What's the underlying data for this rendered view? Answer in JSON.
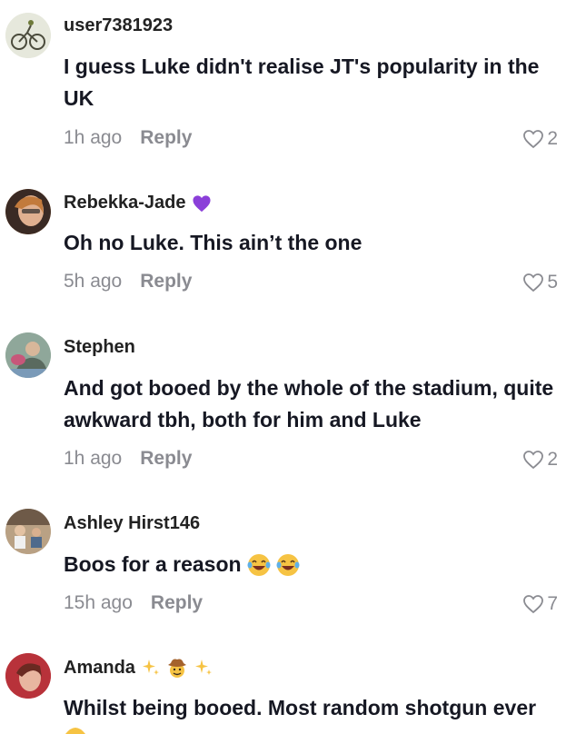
{
  "comments": [
    {
      "username": "user7381923",
      "text": "I guess Luke didn't realise JT's popularity in the UK",
      "time": "1h ago",
      "reply_label": "Reply",
      "likes": "2"
    },
    {
      "username": "Rebekka-Jade",
      "badge_icon": "purple-heart-icon",
      "text": "Oh no Luke. This ain’t the one",
      "time": "5h ago",
      "reply_label": "Reply",
      "likes": "5"
    },
    {
      "username": "Stephen",
      "text": "And got booed by the whole of the stadium, quite awkward tbh, both for him and Luke",
      "time": "1h ago",
      "reply_label": "Reply",
      "likes": "2"
    },
    {
      "username": "Ashley Hirst146",
      "text": "Boos for a reason",
      "text_emojis": [
        "laughing-crying-emoji",
        "laughing-crying-emoji"
      ],
      "time": "15h ago",
      "reply_label": "Reply",
      "likes": "7"
    },
    {
      "username": "Amanda",
      "name_emojis": [
        "sparkles-emoji",
        "cowboy-emoji",
        "sparkles-emoji"
      ],
      "text": "Whilst being booed. Most random shotgun ever"
    }
  ],
  "colors": {
    "text_primary": "#161823",
    "text_secondary": "#8a8b91",
    "heart_badge": "#8b3fd9",
    "emoji_yellow": "#f6c343"
  }
}
